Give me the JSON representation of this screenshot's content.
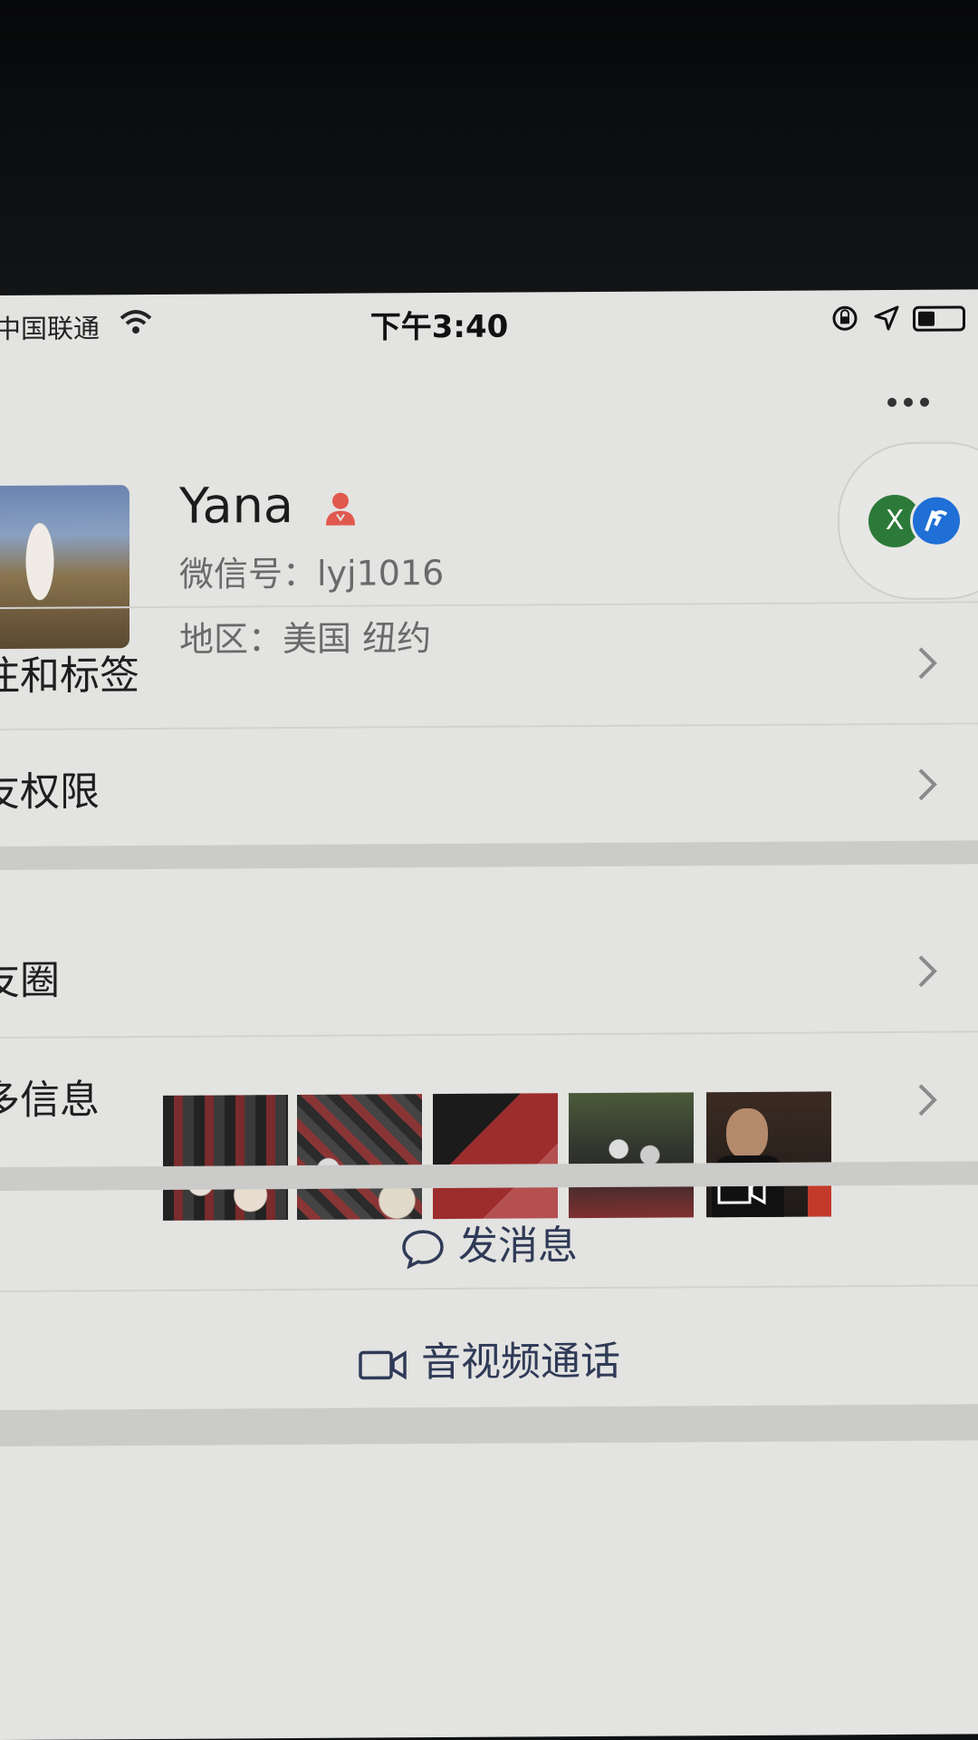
{
  "status_bar": {
    "carrier": "中国联通",
    "time": "下午3:40"
  },
  "profile": {
    "name": "Yana",
    "wechat_id": "微信号：lyj1016",
    "region": "地区：美国 纽约",
    "float_badge_letter": "X"
  },
  "rows": {
    "remarks_tags": "注和标签",
    "friend_permissions": "友权限",
    "moments": "友圈",
    "more_info": "多信息"
  },
  "actions": {
    "send_message": "发消息",
    "video_call": "音视频通话"
  },
  "colors": {
    "accent_link": "#2f3a57",
    "gender_female": "#e0584e",
    "badge_green": "#2c7a3a",
    "badge_blue": "#1f6fd6"
  }
}
